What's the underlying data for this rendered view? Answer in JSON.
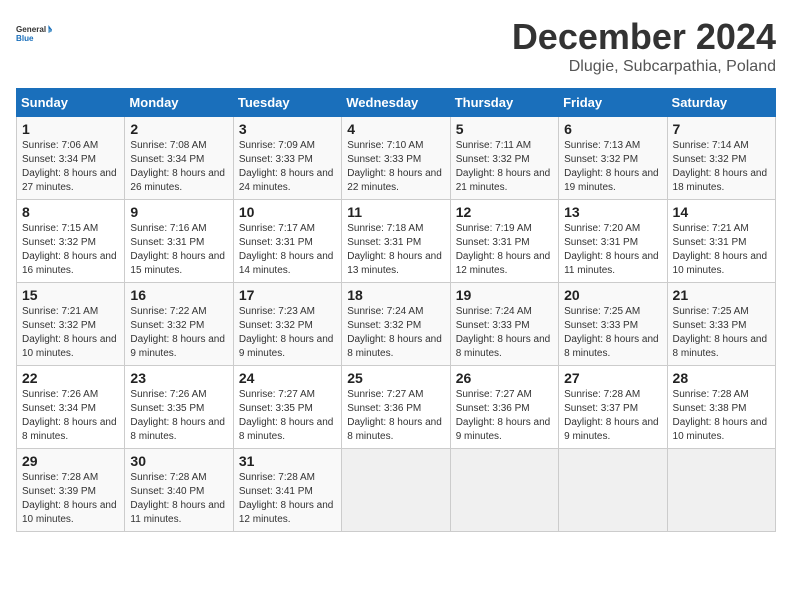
{
  "logo": {
    "general": "General",
    "blue": "Blue"
  },
  "header": {
    "month": "December 2024",
    "location": "Dlugie, Subcarpathia, Poland"
  },
  "weekdays": [
    "Sunday",
    "Monday",
    "Tuesday",
    "Wednesday",
    "Thursday",
    "Friday",
    "Saturday"
  ],
  "weeks": [
    [
      {
        "day": "1",
        "sunrise": "7:06 AM",
        "sunset": "3:34 PM",
        "daylight": "8 hours and 27 minutes."
      },
      {
        "day": "2",
        "sunrise": "7:08 AM",
        "sunset": "3:34 PM",
        "daylight": "8 hours and 26 minutes."
      },
      {
        "day": "3",
        "sunrise": "7:09 AM",
        "sunset": "3:33 PM",
        "daylight": "8 hours and 24 minutes."
      },
      {
        "day": "4",
        "sunrise": "7:10 AM",
        "sunset": "3:33 PM",
        "daylight": "8 hours and 22 minutes."
      },
      {
        "day": "5",
        "sunrise": "7:11 AM",
        "sunset": "3:32 PM",
        "daylight": "8 hours and 21 minutes."
      },
      {
        "day": "6",
        "sunrise": "7:13 AM",
        "sunset": "3:32 PM",
        "daylight": "8 hours and 19 minutes."
      },
      {
        "day": "7",
        "sunrise": "7:14 AM",
        "sunset": "3:32 PM",
        "daylight": "8 hours and 18 minutes."
      }
    ],
    [
      {
        "day": "8",
        "sunrise": "7:15 AM",
        "sunset": "3:32 PM",
        "daylight": "8 hours and 16 minutes."
      },
      {
        "day": "9",
        "sunrise": "7:16 AM",
        "sunset": "3:31 PM",
        "daylight": "8 hours and 15 minutes."
      },
      {
        "day": "10",
        "sunrise": "7:17 AM",
        "sunset": "3:31 PM",
        "daylight": "8 hours and 14 minutes."
      },
      {
        "day": "11",
        "sunrise": "7:18 AM",
        "sunset": "3:31 PM",
        "daylight": "8 hours and 13 minutes."
      },
      {
        "day": "12",
        "sunrise": "7:19 AM",
        "sunset": "3:31 PM",
        "daylight": "8 hours and 12 minutes."
      },
      {
        "day": "13",
        "sunrise": "7:20 AM",
        "sunset": "3:31 PM",
        "daylight": "8 hours and 11 minutes."
      },
      {
        "day": "14",
        "sunrise": "7:21 AM",
        "sunset": "3:31 PM",
        "daylight": "8 hours and 10 minutes."
      }
    ],
    [
      {
        "day": "15",
        "sunrise": "7:21 AM",
        "sunset": "3:32 PM",
        "daylight": "8 hours and 10 minutes."
      },
      {
        "day": "16",
        "sunrise": "7:22 AM",
        "sunset": "3:32 PM",
        "daylight": "8 hours and 9 minutes."
      },
      {
        "day": "17",
        "sunrise": "7:23 AM",
        "sunset": "3:32 PM",
        "daylight": "8 hours and 9 minutes."
      },
      {
        "day": "18",
        "sunrise": "7:24 AM",
        "sunset": "3:32 PM",
        "daylight": "8 hours and 8 minutes."
      },
      {
        "day": "19",
        "sunrise": "7:24 AM",
        "sunset": "3:33 PM",
        "daylight": "8 hours and 8 minutes."
      },
      {
        "day": "20",
        "sunrise": "7:25 AM",
        "sunset": "3:33 PM",
        "daylight": "8 hours and 8 minutes."
      },
      {
        "day": "21",
        "sunrise": "7:25 AM",
        "sunset": "3:33 PM",
        "daylight": "8 hours and 8 minutes."
      }
    ],
    [
      {
        "day": "22",
        "sunrise": "7:26 AM",
        "sunset": "3:34 PM",
        "daylight": "8 hours and 8 minutes."
      },
      {
        "day": "23",
        "sunrise": "7:26 AM",
        "sunset": "3:35 PM",
        "daylight": "8 hours and 8 minutes."
      },
      {
        "day": "24",
        "sunrise": "7:27 AM",
        "sunset": "3:35 PM",
        "daylight": "8 hours and 8 minutes."
      },
      {
        "day": "25",
        "sunrise": "7:27 AM",
        "sunset": "3:36 PM",
        "daylight": "8 hours and 8 minutes."
      },
      {
        "day": "26",
        "sunrise": "7:27 AM",
        "sunset": "3:36 PM",
        "daylight": "8 hours and 9 minutes."
      },
      {
        "day": "27",
        "sunrise": "7:28 AM",
        "sunset": "3:37 PM",
        "daylight": "8 hours and 9 minutes."
      },
      {
        "day": "28",
        "sunrise": "7:28 AM",
        "sunset": "3:38 PM",
        "daylight": "8 hours and 10 minutes."
      }
    ],
    [
      {
        "day": "29",
        "sunrise": "7:28 AM",
        "sunset": "3:39 PM",
        "daylight": "8 hours and 10 minutes."
      },
      {
        "day": "30",
        "sunrise": "7:28 AM",
        "sunset": "3:40 PM",
        "daylight": "8 hours and 11 minutes."
      },
      {
        "day": "31",
        "sunrise": "7:28 AM",
        "sunset": "3:41 PM",
        "daylight": "8 hours and 12 minutes."
      },
      null,
      null,
      null,
      null
    ]
  ]
}
